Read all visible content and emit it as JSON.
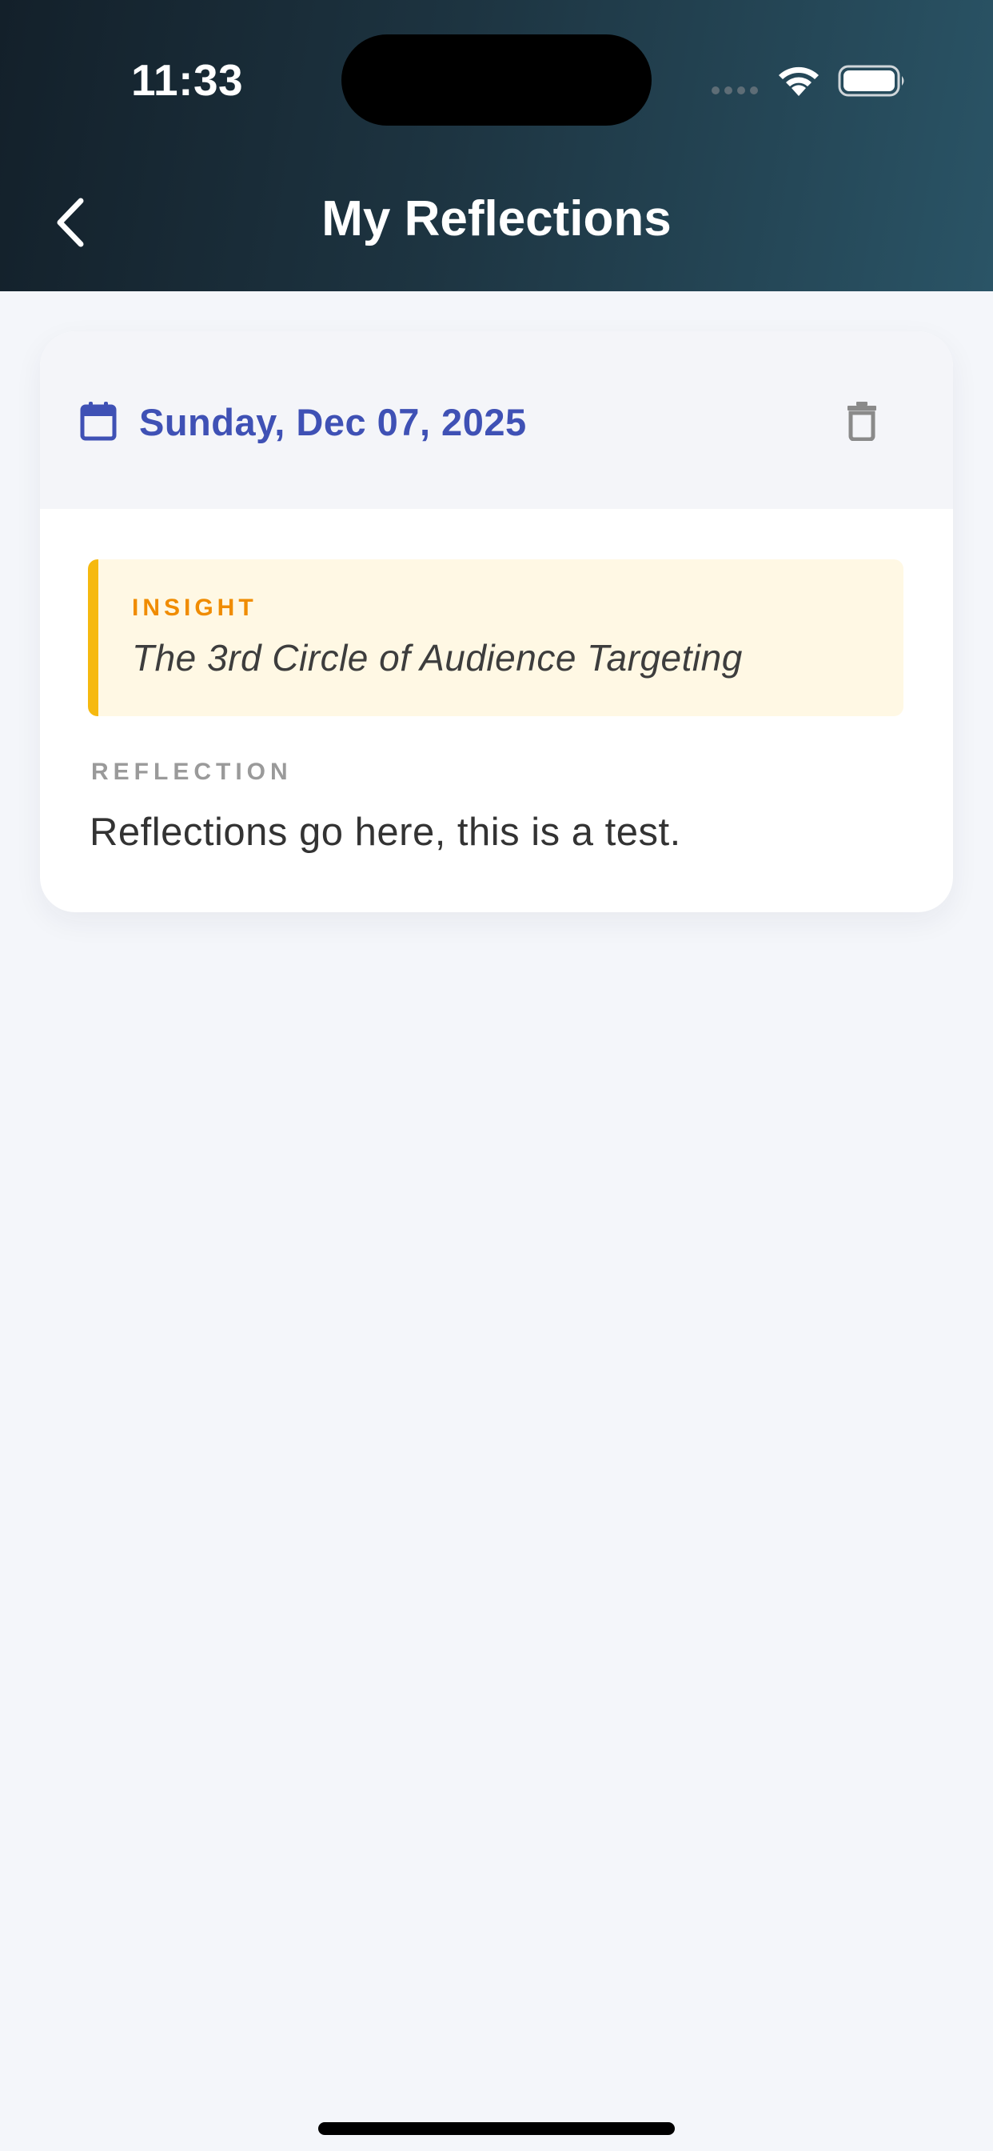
{
  "status_bar": {
    "time": "11:33"
  },
  "header": {
    "title": "My Reflections",
    "back_icon": "chevron-left-icon"
  },
  "reflection_card": {
    "date": "Sunday, Dec 07, 2025",
    "calendar_icon": "calendar-icon",
    "delete_icon": "trash-icon",
    "insight": {
      "label": "INSIGHT",
      "text": "The 3rd Circle of Audience Targeting"
    },
    "reflection": {
      "label": "REFLECTION",
      "text": "Reflections go here, this is a test."
    }
  },
  "colors": {
    "header_gradient_start": "#13202a",
    "header_gradient_end": "#2a5466",
    "date_accent": "#3f51b5",
    "insight_label": "#f08c00",
    "insight_bar": "#f6b90f",
    "insight_background": "#fff8e4",
    "page_background": "#f4f6fa"
  }
}
